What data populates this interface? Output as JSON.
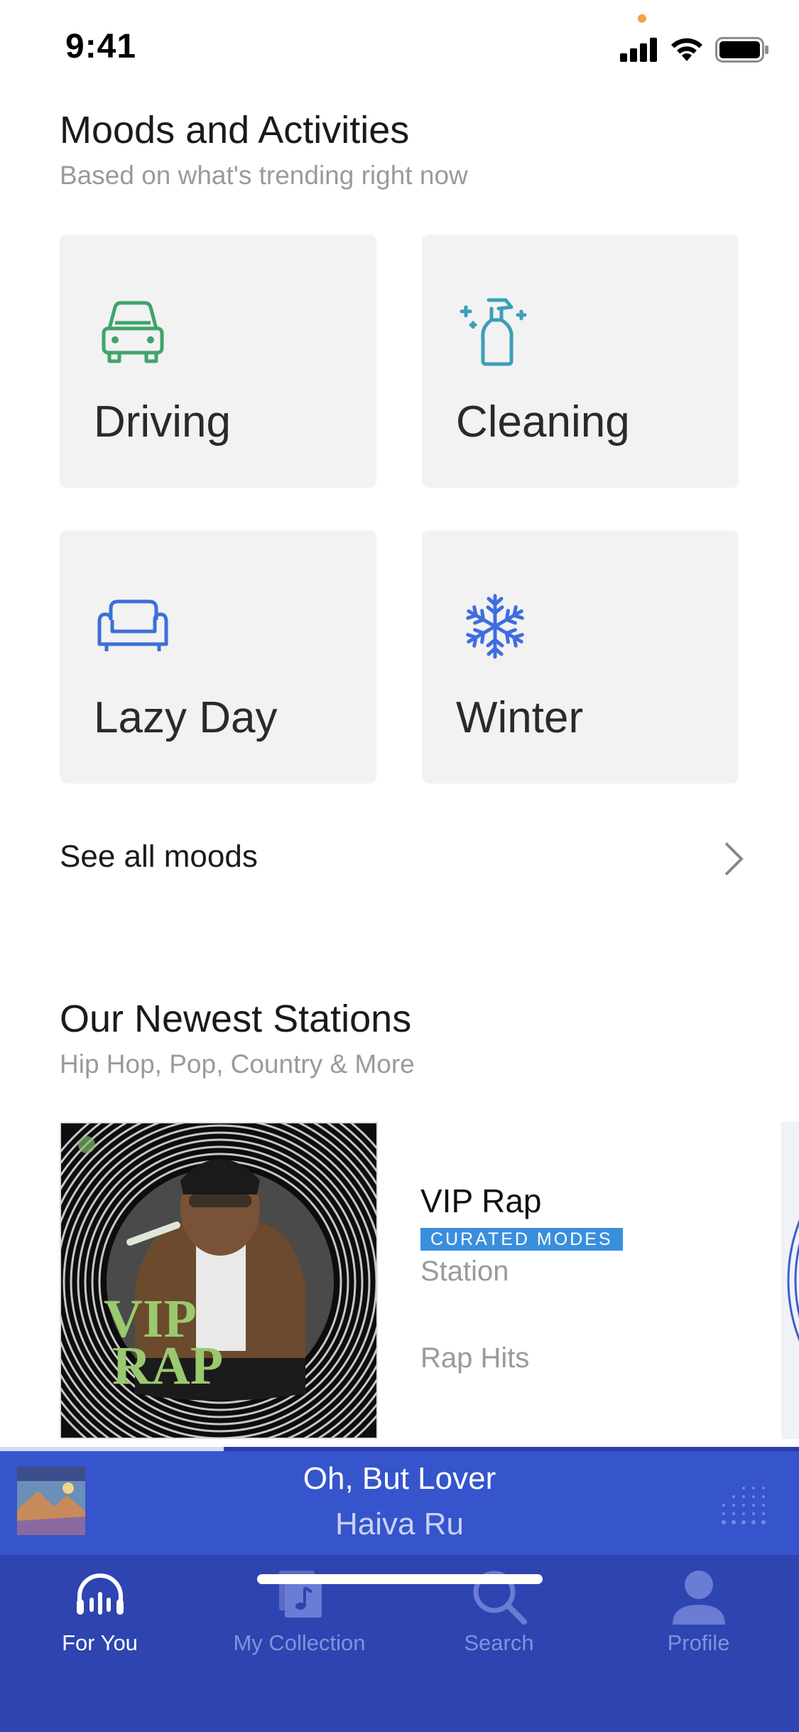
{
  "status_bar": {
    "time": "9:41",
    "icons": [
      "cellular-signal-icon",
      "wifi-icon",
      "battery-icon"
    ],
    "privacy_dot_color": "#f4a342"
  },
  "moods": {
    "title": "Moods and Activities",
    "subtitle": "Based on what's trending right now",
    "tiles": [
      {
        "label": "Driving",
        "icon": "car-icon",
        "icon_color": "#3fa46a"
      },
      {
        "label": "Cleaning",
        "icon": "spray-bottle-icon",
        "icon_color": "#3a9fb8"
      },
      {
        "label": "Lazy Day",
        "icon": "couch-icon",
        "icon_color": "#3d6fd6"
      },
      {
        "label": "Winter",
        "icon": "snowflake-icon",
        "icon_color": "#3f6de0"
      }
    ],
    "see_all_label": "See all moods"
  },
  "stations": {
    "title": "Our Newest Stations",
    "subtitle": "Hip Hop, Pop, Country & More",
    "items": [
      {
        "title": "VIP Rap",
        "badge": "CURATED MODES",
        "type": "Station",
        "genre": "Rap Hits",
        "art_text": [
          "VIP",
          "RAP"
        ]
      }
    ]
  },
  "now_playing": {
    "title": "Oh, But Lover",
    "artist": "Haiva Ru",
    "progress": 0.28
  },
  "tab_bar": {
    "tabs": [
      {
        "label": "For You",
        "icon": "headphones-icon",
        "active": true
      },
      {
        "label": "My Collection",
        "icon": "music-collection-icon",
        "active": false
      },
      {
        "label": "Search",
        "icon": "search-icon",
        "active": false
      },
      {
        "label": "Profile",
        "icon": "profile-icon",
        "active": false
      }
    ]
  },
  "colors": {
    "accent_blue": "#3654cc",
    "tab_bar": "#2e44b0",
    "badge": "#3a8fdd",
    "tile_bg": "#f2f2f2"
  }
}
